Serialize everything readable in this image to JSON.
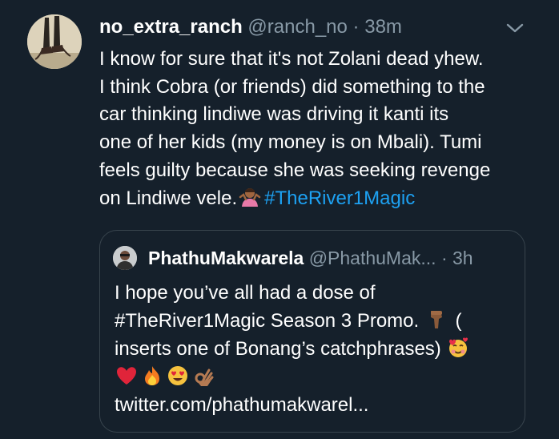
{
  "tweet": {
    "display_name": "no_extra_ranch",
    "handle": "@ranch_no",
    "separator": "·",
    "time": "38m",
    "text_lines": [
      "I know for sure that it's not Zolani dead yhew.",
      "I think Cobra (or friends) did something to the",
      "car thinking lindiwe was driving it kanti its",
      "one of her kids (my money is on Mbali). Tumi",
      "feels guilty because she was seeking revenge",
      "on Lindiwe vele."
    ],
    "hashtag": "#TheRiver1Magic",
    "emoji": "person-shrugging"
  },
  "quoted_tweet": {
    "display_name": "PhathuMakwarela",
    "handle": "@PhathuMak...",
    "separator": "·",
    "time": "3h",
    "text_lines": [
      "I hope you’ve all had a dose of",
      "#TheRiver1Magic Season 3 Promo.",
      "(",
      "inserts one of Bonang’s catchphrases)"
    ],
    "emojis_line1": [
      "pointing-down-hand"
    ],
    "emojis_line2": [
      "smiling-face-with-hearts"
    ],
    "emojis_line3": [
      "red-heart",
      "fire",
      "heart-eyes-face",
      "ok-hand"
    ],
    "link": "twitter.com/phathumakwarel..."
  },
  "colors": {
    "background": "#15202b",
    "text": "#ffffff",
    "secondary": "#8899a6",
    "accent": "#1da1f2",
    "border": "#38444d"
  }
}
